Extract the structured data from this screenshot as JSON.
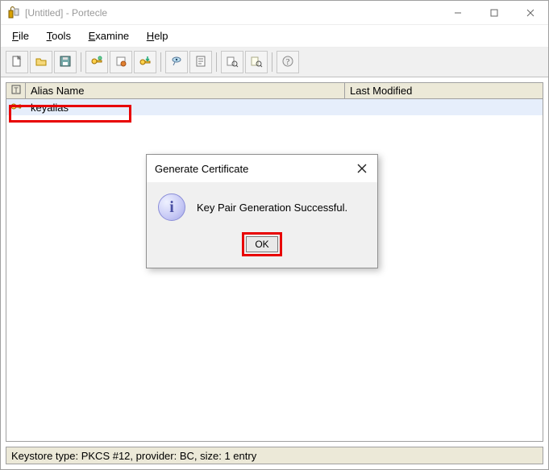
{
  "window": {
    "title": "[Untitled] - Portecle"
  },
  "menu": {
    "file": "File",
    "tools": "Tools",
    "examine": "Examine",
    "help": "Help"
  },
  "toolbar": {
    "new": "new-keystore",
    "open": "open-keystore",
    "save": "save-keystore",
    "genkey": "generate-key-pair",
    "importcert": "import-trusted-cert",
    "importpair": "import-key-pair",
    "setpass": "set-keystore-password",
    "report": "keystore-report",
    "examine_cert": "examine-certificate",
    "examine_crl": "examine-crl",
    "help": "help"
  },
  "table": {
    "columns": {
      "alias": "Alias Name",
      "modified": "Last Modified"
    },
    "rows": [
      {
        "alias": "keyalias",
        "modified": ""
      }
    ]
  },
  "dialog": {
    "title": "Generate Certificate",
    "message": "Key Pair Generation Successful.",
    "ok": "OK"
  },
  "statusbar": {
    "text": "Keystore type: PKCS #12, provider: BC, size: 1 entry"
  }
}
